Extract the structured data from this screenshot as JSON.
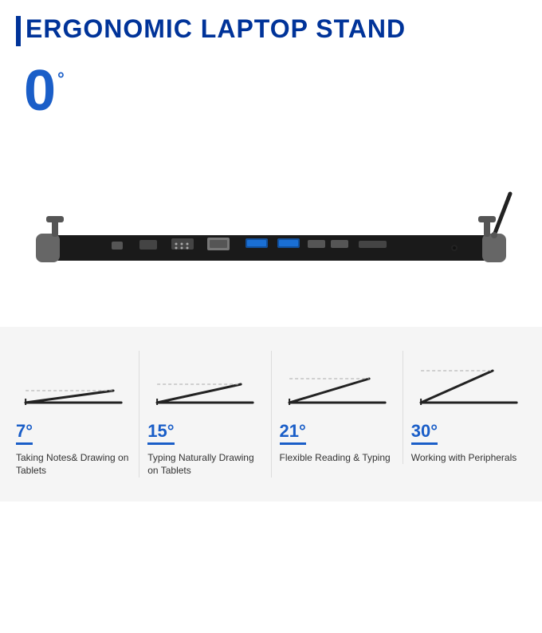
{
  "header": {
    "title": "ERGONOMIC LAPTOP STAND"
  },
  "angle": {
    "current": "0",
    "degree_symbol": "°"
  },
  "features": [
    {
      "angle": "7",
      "description": "Taking Notes& Drawing on Tablets",
      "svg_angle_rad": 0.122
    },
    {
      "angle": "15",
      "description": "Typing Naturally Drawing on Tablets",
      "svg_angle_rad": 0.262
    },
    {
      "angle": "21",
      "description": "Flexible Reading & Typing",
      "svg_angle_rad": 0.367
    },
    {
      "angle": "30",
      "description": "Working with Peripherals",
      "svg_angle_rad": 0.524
    }
  ]
}
